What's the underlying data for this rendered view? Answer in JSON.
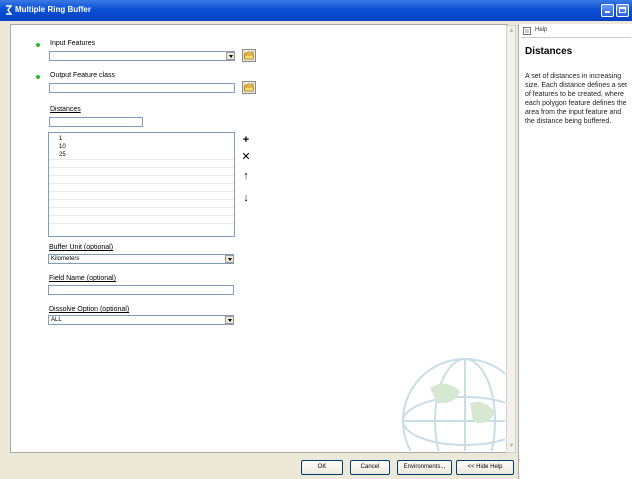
{
  "window": {
    "title": "Multiple Ring Buffer"
  },
  "form": {
    "input_features": {
      "label": "Input Features",
      "value": ""
    },
    "output_feature_class": {
      "label": "Output Feature class",
      "value": ""
    },
    "distances": {
      "label": "Distances",
      "value": "",
      "items": [
        "1",
        "10",
        "25"
      ]
    },
    "buffer_unit": {
      "label": "Buffer Unit (optional)",
      "value": "Kilometers"
    },
    "field_name": {
      "label": "Field Name (optional)",
      "value": ""
    },
    "dissolve_option": {
      "label": "Dissolve Option (optional)",
      "value": "ALL"
    }
  },
  "list_buttons": [
    "add-icon",
    "delete-icon",
    "move-up-icon",
    "move-down-icon"
  ],
  "help": {
    "tab_label": "Help",
    "title": "Distances",
    "text": "A set of distances in increasing size. Each distance defines a set of features to be created, where each polygon feature defines the area from the input feature and the distance being buffered."
  },
  "buttons": {
    "ok": "OK",
    "cancel": "Cancel",
    "environments": "Environments...",
    "hide_help": "<< Hide Help"
  },
  "colors": {
    "titlebar": "#0a4fd4",
    "required_dot": "#2cb52c",
    "frame": "#ece9d8"
  }
}
